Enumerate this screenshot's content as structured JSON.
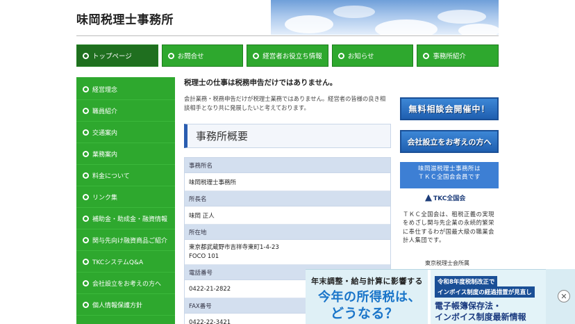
{
  "header": {
    "site_title": "味岡税理士事務所"
  },
  "topnav": [
    {
      "label": "トップページ"
    },
    {
      "label": "お問合せ"
    },
    {
      "label": "経営者お役立ち情報"
    },
    {
      "label": "お知らせ"
    },
    {
      "label": "事務所紹介"
    }
  ],
  "sidebar": [
    {
      "label": "経営理念"
    },
    {
      "label": "職員紹介"
    },
    {
      "label": "交通案内"
    },
    {
      "label": "業務案内"
    },
    {
      "label": "料金について"
    },
    {
      "label": "リンク集"
    },
    {
      "label": "補助金・助成金・融資情報"
    },
    {
      "label": "関与先向け融資商品ご紹介"
    },
    {
      "label": "TKCシステムQ&A"
    },
    {
      "label": "会社設立をお考えの方へ"
    },
    {
      "label": "個人情報保護方針"
    }
  ],
  "main": {
    "intro_title": "税理士の仕事は税務申告だけではありません。",
    "intro_text": "会計業務・税務申告だけが税理士業務ではありません。経営者の皆様の良き相談相手となり共に発展したいと考えております。",
    "section_title": "事務所概要",
    "table": [
      {
        "label": "事務所名",
        "value": [
          "味岡税理士事務所"
        ]
      },
      {
        "label": "所長名",
        "value": [
          "味岡 正人"
        ]
      },
      {
        "label": "所在地",
        "value": [
          "東京都武蔵野市吉祥寺東町1-4-23",
          "FOCO 101"
        ]
      },
      {
        "label": "電話番号",
        "value": [
          "0422-21-2822"
        ]
      },
      {
        "label": "FAX番号",
        "value": [
          "0422-22-3421"
        ]
      }
    ]
  },
  "right": {
    "banner1": "無料相談会開催中！",
    "banner2": "会社設立をお考えの方へ",
    "tkc_box_line1": "味岡滋税理士事務所は",
    "tkc_box_line2": "ＴＫＣ全国会会員です",
    "tkc_logo": "TKC全国会",
    "tkc_desc": "ＴＫＣ全国会は、租税正義の実現をめざし関与先企業の永続的繁栄に奉仕するわが国最大級の職業会計人集団です。",
    "tkc_foot": "東京税理士会所属"
  },
  "ad": {
    "line1": "年末調整・給与計算に影響する",
    "big1": "今年の所得税は、",
    "big2": "どうなる？",
    "r1": "令和8年度税制改正で",
    "r2": "インボイス制度の経過措置が見直し",
    "r3": "電子帳簿保存法・",
    "r4": "インボイス制度最新情報",
    "close": "✕"
  },
  "colors": {
    "green": "#2ea82e",
    "dark_green": "#1f6f1f",
    "blue": "#2a5db0",
    "table_header": "#d3dfef"
  }
}
